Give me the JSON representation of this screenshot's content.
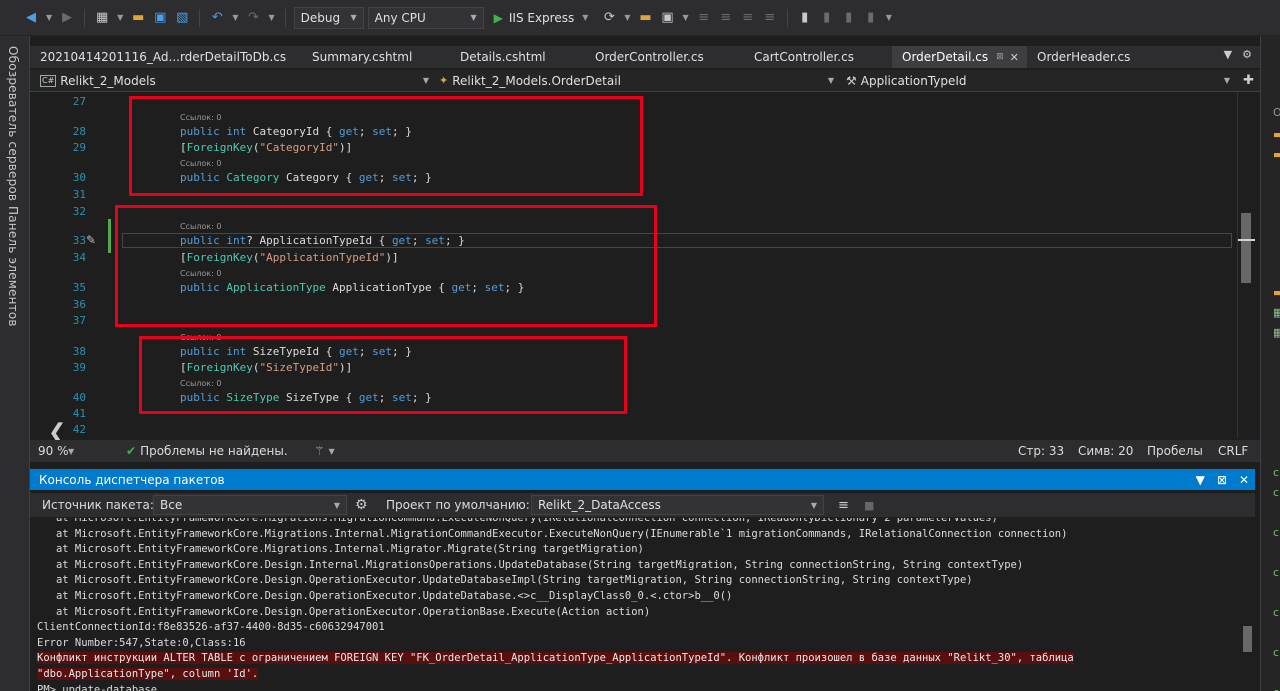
{
  "toolbar": {
    "config": "Debug",
    "platform": "Any CPU",
    "run_label": "IIS Express"
  },
  "side_tabs": {
    "server_explorer": "Обозреватель серверов",
    "toolbox": "Панель элементов"
  },
  "tabs": [
    {
      "label": "20210414201116_Ad...rderDetailToDb.cs",
      "active": false
    },
    {
      "label": "Summary.cshtml",
      "active": false
    },
    {
      "label": "Details.cshtml",
      "active": false
    },
    {
      "label": "OrderController.cs",
      "active": false
    },
    {
      "label": "CartController.cs",
      "active": false
    },
    {
      "label": "OrderDetail.cs",
      "active": true
    },
    {
      "label": "OrderHeader.cs",
      "active": false
    }
  ],
  "nav": {
    "project": "Relikt_2_Models",
    "project_badge": "C#",
    "class": "Relikt_2_Models.OrderDetail",
    "member": "ApplicationTypeId"
  },
  "code": {
    "refs_label": "Ссылок: 0",
    "lines": [
      {
        "n": "27",
        "tokens": []
      },
      {
        "n": "28",
        "tokens": [
          [
            "kw",
            "public "
          ],
          [
            "kw",
            "int "
          ],
          [
            "plain",
            "CategoryId { "
          ],
          [
            "kw",
            "get"
          ],
          [
            "plain",
            "; "
          ],
          [
            "kw",
            "set"
          ],
          [
            "plain",
            "; }"
          ]
        ]
      },
      {
        "n": "29",
        "tokens": [
          [
            "plain",
            "["
          ],
          [
            "ty",
            "ForeignKey"
          ],
          [
            "plain",
            "("
          ],
          [
            "st",
            "\"CategoryId\""
          ],
          [
            "plain",
            ")]"
          ]
        ]
      },
      {
        "n": "30",
        "tokens": [
          [
            "kw",
            "public "
          ],
          [
            "ty",
            "Category "
          ],
          [
            "plain",
            "Category { "
          ],
          [
            "kw",
            "get"
          ],
          [
            "plain",
            "; "
          ],
          [
            "kw",
            "set"
          ],
          [
            "plain",
            "; }"
          ]
        ]
      },
      {
        "n": "31",
        "tokens": []
      },
      {
        "n": "32",
        "tokens": []
      },
      {
        "n": "33",
        "tokens": [
          [
            "kw",
            "public "
          ],
          [
            "kw",
            "int"
          ],
          [
            "plain",
            "? ApplicationTypeId { "
          ],
          [
            "kw",
            "get"
          ],
          [
            "plain",
            "; "
          ],
          [
            "kw",
            "set"
          ],
          [
            "plain",
            "; }"
          ]
        ]
      },
      {
        "n": "34",
        "tokens": [
          [
            "plain",
            "["
          ],
          [
            "ty",
            "ForeignKey"
          ],
          [
            "plain",
            "("
          ],
          [
            "st",
            "\"ApplicationTypeId\""
          ],
          [
            "plain",
            ")]"
          ]
        ]
      },
      {
        "n": "35",
        "tokens": [
          [
            "kw",
            "public "
          ],
          [
            "ty",
            "ApplicationType "
          ],
          [
            "plain",
            "ApplicationType { "
          ],
          [
            "kw",
            "get"
          ],
          [
            "plain",
            "; "
          ],
          [
            "kw",
            "set"
          ],
          [
            "plain",
            "; }"
          ]
        ]
      },
      {
        "n": "36",
        "tokens": []
      },
      {
        "n": "37",
        "tokens": []
      },
      {
        "n": "38",
        "tokens": [
          [
            "kw",
            "public "
          ],
          [
            "kw",
            "int "
          ],
          [
            "plain",
            "SizeTypeId { "
          ],
          [
            "kw",
            "get"
          ],
          [
            "plain",
            "; "
          ],
          [
            "kw",
            "set"
          ],
          [
            "plain",
            "; }"
          ]
        ]
      },
      {
        "n": "39",
        "tokens": [
          [
            "plain",
            "["
          ],
          [
            "ty",
            "ForeignKey"
          ],
          [
            "plain",
            "("
          ],
          [
            "st",
            "\"SizeTypeId\""
          ],
          [
            "plain",
            ")]"
          ]
        ]
      },
      {
        "n": "40",
        "tokens": [
          [
            "kw",
            "public "
          ],
          [
            "ty",
            "SizeType "
          ],
          [
            "plain",
            "SizeType { "
          ],
          [
            "kw",
            "get"
          ],
          [
            "plain",
            "; "
          ],
          [
            "kw",
            "set"
          ],
          [
            "plain",
            "; }"
          ]
        ]
      },
      {
        "n": "41",
        "tokens": []
      },
      {
        "n": "42",
        "tokens": []
      }
    ]
  },
  "status": {
    "zoom": "90 %",
    "issues": "Проблемы не найдены.",
    "line": "Стр: 33",
    "col": "Симв: 20",
    "spaces": "Пробелы",
    "eol": "CRLF"
  },
  "pmc": {
    "title": "Консоль диспетчера пакетов",
    "source_label": "Источник пакета:",
    "source_value": "Все",
    "default_project_label": "Проект по умолчанию:",
    "default_project_value": "Relikt_2_DataAccess",
    "output": [
      {
        "text": "   at Microsoft.EntityFrameworkCore.Migrations.MigrationCommand.ExecuteNonQuery(IRelationalConnection connection, IReadOnlyDictionary`2 parameterValues)",
        "error": false
      },
      {
        "text": "   at Microsoft.EntityFrameworkCore.Migrations.Internal.MigrationCommandExecutor.ExecuteNonQuery(IEnumerable`1 migrationCommands, IRelationalConnection connection)",
        "error": false
      },
      {
        "text": "   at Microsoft.EntityFrameworkCore.Migrations.Internal.Migrator.Migrate(String targetMigration)",
        "error": false
      },
      {
        "text": "   at Microsoft.EntityFrameworkCore.Design.Internal.MigrationsOperations.UpdateDatabase(String targetMigration, String connectionString, String contextType)",
        "error": false
      },
      {
        "text": "   at Microsoft.EntityFrameworkCore.Design.OperationExecutor.UpdateDatabaseImpl(String targetMigration, String connectionString, String contextType)",
        "error": false
      },
      {
        "text": "   at Microsoft.EntityFrameworkCore.Design.OperationExecutor.UpdateDatabase.<>c__DisplayClass0_0.<.ctor>b__0()",
        "error": false
      },
      {
        "text": "   at Microsoft.EntityFrameworkCore.Design.OperationExecutor.OperationBase.Execute(Action action)",
        "error": false
      },
      {
        "text": "ClientConnectionId:f8e83526-af37-4400-8d35-c60632947001",
        "error": false
      },
      {
        "text": "Error Number:547,State:0,Class:16",
        "error": false
      },
      {
        "text": "Конфликт инструкции ALTER TABLE с ограничением FOREIGN KEY \"FK_OrderDetail_ApplicationType_ApplicationTypeId\". Конфликт произошел в базе данных \"Relikt_30\", таблица",
        "error": true
      },
      {
        "text": "\"dbo.ApplicationType\", column 'Id'.",
        "error": true
      },
      {
        "text": "PM> update-database",
        "error": false
      }
    ]
  },
  "colors": {
    "accent": "#007acc",
    "highlight_box": "#e8001c",
    "error_bg": "#5a0f0f"
  }
}
